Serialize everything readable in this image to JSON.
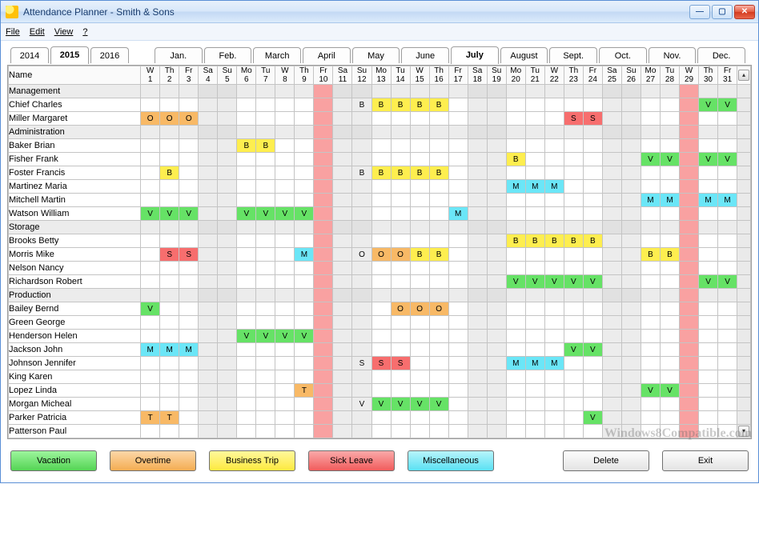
{
  "window": {
    "title": "Attendance Planner - Smith & Sons"
  },
  "menu": {
    "file": "File",
    "edit": "Edit",
    "view": "View",
    "help": "?"
  },
  "years": {
    "items": [
      "2014",
      "2015",
      "2016"
    ],
    "active": "2015"
  },
  "months": {
    "items": [
      "Jan.",
      "Feb.",
      "March",
      "April",
      "May",
      "June",
      "July",
      "August",
      "Sept.",
      "Oct.",
      "Nov.",
      "Dec."
    ],
    "active": "July"
  },
  "grid": {
    "name_header": "Name",
    "days": [
      {
        "dow": "W",
        "num": "1",
        "weekend": false,
        "holiday": false
      },
      {
        "dow": "Th",
        "num": "2",
        "weekend": false,
        "holiday": false
      },
      {
        "dow": "Fr",
        "num": "3",
        "weekend": false,
        "holiday": false
      },
      {
        "dow": "Sa",
        "num": "4",
        "weekend": true,
        "holiday": false
      },
      {
        "dow": "Su",
        "num": "5",
        "weekend": true,
        "holiday": false
      },
      {
        "dow": "Mo",
        "num": "6",
        "weekend": false,
        "holiday": false
      },
      {
        "dow": "Tu",
        "num": "7",
        "weekend": false,
        "holiday": false
      },
      {
        "dow": "W",
        "num": "8",
        "weekend": false,
        "holiday": false
      },
      {
        "dow": "Th",
        "num": "9",
        "weekend": false,
        "holiday": false
      },
      {
        "dow": "Fr",
        "num": "10",
        "weekend": false,
        "holiday": true
      },
      {
        "dow": "Sa",
        "num": "11",
        "weekend": true,
        "holiday": false
      },
      {
        "dow": "Su",
        "num": "12",
        "weekend": true,
        "holiday": false
      },
      {
        "dow": "Mo",
        "num": "13",
        "weekend": false,
        "holiday": false
      },
      {
        "dow": "Tu",
        "num": "14",
        "weekend": false,
        "holiday": false
      },
      {
        "dow": "W",
        "num": "15",
        "weekend": false,
        "holiday": false
      },
      {
        "dow": "Th",
        "num": "16",
        "weekend": false,
        "holiday": false
      },
      {
        "dow": "Fr",
        "num": "17",
        "weekend": false,
        "holiday": false
      },
      {
        "dow": "Sa",
        "num": "18",
        "weekend": true,
        "holiday": false
      },
      {
        "dow": "Su",
        "num": "19",
        "weekend": true,
        "holiday": false
      },
      {
        "dow": "Mo",
        "num": "20",
        "weekend": false,
        "holiday": false
      },
      {
        "dow": "Tu",
        "num": "21",
        "weekend": false,
        "holiday": false
      },
      {
        "dow": "W",
        "num": "22",
        "weekend": false,
        "holiday": false
      },
      {
        "dow": "Th",
        "num": "23",
        "weekend": false,
        "holiday": false
      },
      {
        "dow": "Fr",
        "num": "24",
        "weekend": false,
        "holiday": false
      },
      {
        "dow": "Sa",
        "num": "25",
        "weekend": true,
        "holiday": false
      },
      {
        "dow": "Su",
        "num": "26",
        "weekend": true,
        "holiday": false
      },
      {
        "dow": "Mo",
        "num": "27",
        "weekend": false,
        "holiday": false
      },
      {
        "dow": "Tu",
        "num": "28",
        "weekend": false,
        "holiday": false
      },
      {
        "dow": "W",
        "num": "29",
        "weekend": false,
        "holiday": true
      },
      {
        "dow": "Th",
        "num": "30",
        "weekend": false,
        "holiday": false
      },
      {
        "dow": "Fr",
        "num": "31",
        "weekend": false,
        "holiday": false
      }
    ],
    "rows": [
      {
        "name": "Management",
        "section": true,
        "cells": {}
      },
      {
        "name": "Chief Charles",
        "cells": {
          "12": "B",
          "13": "B",
          "14": "B",
          "15": "B",
          "16": "B",
          "30": "V",
          "31": "V"
        }
      },
      {
        "name": "Miller Margaret",
        "cells": {
          "1": "O",
          "2": "O",
          "3": "O",
          "23": "S",
          "24": "S"
        }
      },
      {
        "name": "Administration",
        "section": true,
        "cells": {}
      },
      {
        "name": "Baker Brian",
        "cells": {
          "6": "B",
          "7": "B"
        }
      },
      {
        "name": "Fisher Frank",
        "cells": {
          "20": "B",
          "27": "V",
          "28": "V",
          "30": "V",
          "31": "V"
        }
      },
      {
        "name": "Foster Francis",
        "cells": {
          "2": "B",
          "12": "B",
          "13": "B",
          "14": "B",
          "15": "B",
          "16": "B"
        }
      },
      {
        "name": "Martinez Maria",
        "cells": {
          "20": "M",
          "21": "M",
          "22": "M"
        }
      },
      {
        "name": "Mitchell Martin",
        "cells": {
          "27": "M",
          "28": "M",
          "30": "M",
          "31": "M"
        }
      },
      {
        "name": "Watson William",
        "cells": {
          "1": "V",
          "2": "V",
          "3": "V",
          "6": "V",
          "7": "V",
          "8": "V",
          "9": "V",
          "17": "M"
        }
      },
      {
        "name": "Storage",
        "section": true,
        "cells": {}
      },
      {
        "name": "Brooks Betty",
        "cells": {
          "20": "B",
          "21": "B",
          "22": "B",
          "23": "B",
          "24": "B"
        }
      },
      {
        "name": "Morris Mike",
        "cells": {
          "2": "S",
          "3": "S",
          "9": "M",
          "12": "O",
          "13": "O",
          "14": "O",
          "15": "B",
          "16": "B",
          "27": "B",
          "28": "B"
        }
      },
      {
        "name": "Nelson Nancy",
        "cells": {}
      },
      {
        "name": "Richardson Robert",
        "cells": {
          "20": "V",
          "21": "V",
          "22": "V",
          "23": "V",
          "24": "V",
          "30": "V",
          "31": "V"
        }
      },
      {
        "name": "Production",
        "section": true,
        "cells": {}
      },
      {
        "name": "Bailey Bernd",
        "cells": {
          "1": "V",
          "14": "O",
          "15": "O",
          "16": "O"
        }
      },
      {
        "name": "Green George",
        "cells": {}
      },
      {
        "name": "Henderson Helen",
        "cells": {
          "6": "V",
          "7": "V",
          "8": "V",
          "9": "V"
        }
      },
      {
        "name": "Jackson John",
        "cells": {
          "1": "M",
          "2": "M",
          "3": "M",
          "23": "V",
          "24": "V"
        }
      },
      {
        "name": "Johnson Jennifer",
        "cells": {
          "12": "S",
          "13": "S",
          "14": "S",
          "20": "M",
          "21": "M",
          "22": "M"
        }
      },
      {
        "name": "King Karen",
        "cells": {}
      },
      {
        "name": "Lopez Linda",
        "cells": {
          "9": "T",
          "27": "V",
          "28": "V"
        }
      },
      {
        "name": "Morgan Micheal",
        "cells": {
          "12": "V",
          "13": "V",
          "14": "V",
          "15": "V",
          "16": "V"
        }
      },
      {
        "name": "Parker Patricia",
        "cells": {
          "1": "T",
          "2": "T",
          "24": "V"
        }
      },
      {
        "name": "Patterson Paul",
        "cells": {}
      }
    ]
  },
  "legend": {
    "vacation": "Vacation",
    "overtime": "Overtime",
    "business": "Business Trip",
    "sick": "Sick Leave",
    "misc": "Miscellaneous",
    "delete": "Delete",
    "exit": "Exit"
  },
  "watermark": "Windows8Compatible.com"
}
